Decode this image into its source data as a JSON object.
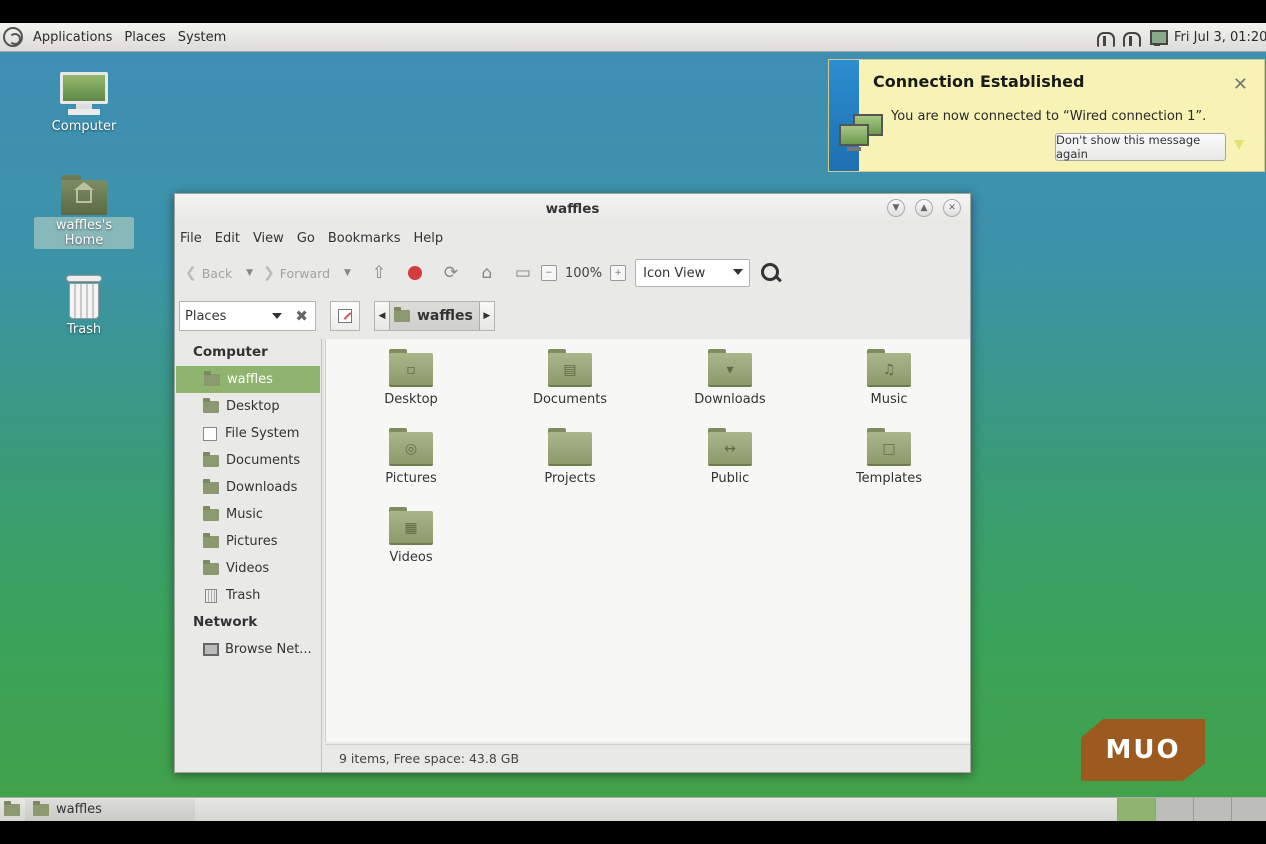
{
  "top_panel": {
    "menus": [
      "Applications",
      "Places",
      "System"
    ],
    "clock": "Fri Jul 3, 01:20"
  },
  "desktop_icons": [
    {
      "label": "Computer",
      "icon": "computer-icon"
    },
    {
      "label": "waffles's Home",
      "icon": "home-folder-icon",
      "selected": true
    },
    {
      "label": "Trash",
      "icon": "trash-icon"
    }
  ],
  "notification": {
    "title": "Connection Established",
    "message": "You are now connected to “Wired connection 1”.",
    "button": "Don't show this message again",
    "close": "✕",
    "colors": {
      "background": "#f6f3b5",
      "stripe": "#2d8ed0"
    }
  },
  "window": {
    "title": "waffles",
    "menubar": [
      "File",
      "Edit",
      "View",
      "Go",
      "Bookmarks",
      "Help"
    ],
    "toolbar": {
      "back": "Back",
      "forward": "Forward",
      "zoom": "100%",
      "view_mode": "Icon View"
    },
    "location": {
      "places_label": "Places",
      "crumb": "waffles"
    },
    "sidebar": {
      "computer_header": "Computer",
      "computer_items": [
        {
          "label": "waffles",
          "icon": "home-folder-icon",
          "active": true
        },
        {
          "label": "Desktop",
          "icon": "folder-icon"
        },
        {
          "label": "File System",
          "icon": "drive-icon"
        },
        {
          "label": "Documents",
          "icon": "folder-icon"
        },
        {
          "label": "Downloads",
          "icon": "folder-icon"
        },
        {
          "label": "Music",
          "icon": "folder-icon"
        },
        {
          "label": "Pictures",
          "icon": "folder-icon"
        },
        {
          "label": "Videos",
          "icon": "folder-icon"
        },
        {
          "label": "Trash",
          "icon": "trash-icon"
        }
      ],
      "network_header": "Network",
      "network_items": [
        {
          "label": "Browse Net...",
          "icon": "network-icon"
        }
      ]
    },
    "files": [
      {
        "name": "Desktop",
        "emblem": "▫"
      },
      {
        "name": "Documents",
        "emblem": "▤"
      },
      {
        "name": "Downloads",
        "emblem": "▾"
      },
      {
        "name": "Music",
        "emblem": "♫"
      },
      {
        "name": "Pictures",
        "emblem": "◎"
      },
      {
        "name": "Projects",
        "emblem": ""
      },
      {
        "name": "Public",
        "emblem": "↔"
      },
      {
        "name": "Templates",
        "emblem": "□"
      },
      {
        "name": "Videos",
        "emblem": "▦"
      }
    ],
    "status": "9 items, Free space: 43.8 GB",
    "colors": {
      "accent": "#8fb46d"
    }
  },
  "taskbar": {
    "task_label": "waffles"
  },
  "watermark": "MUO"
}
